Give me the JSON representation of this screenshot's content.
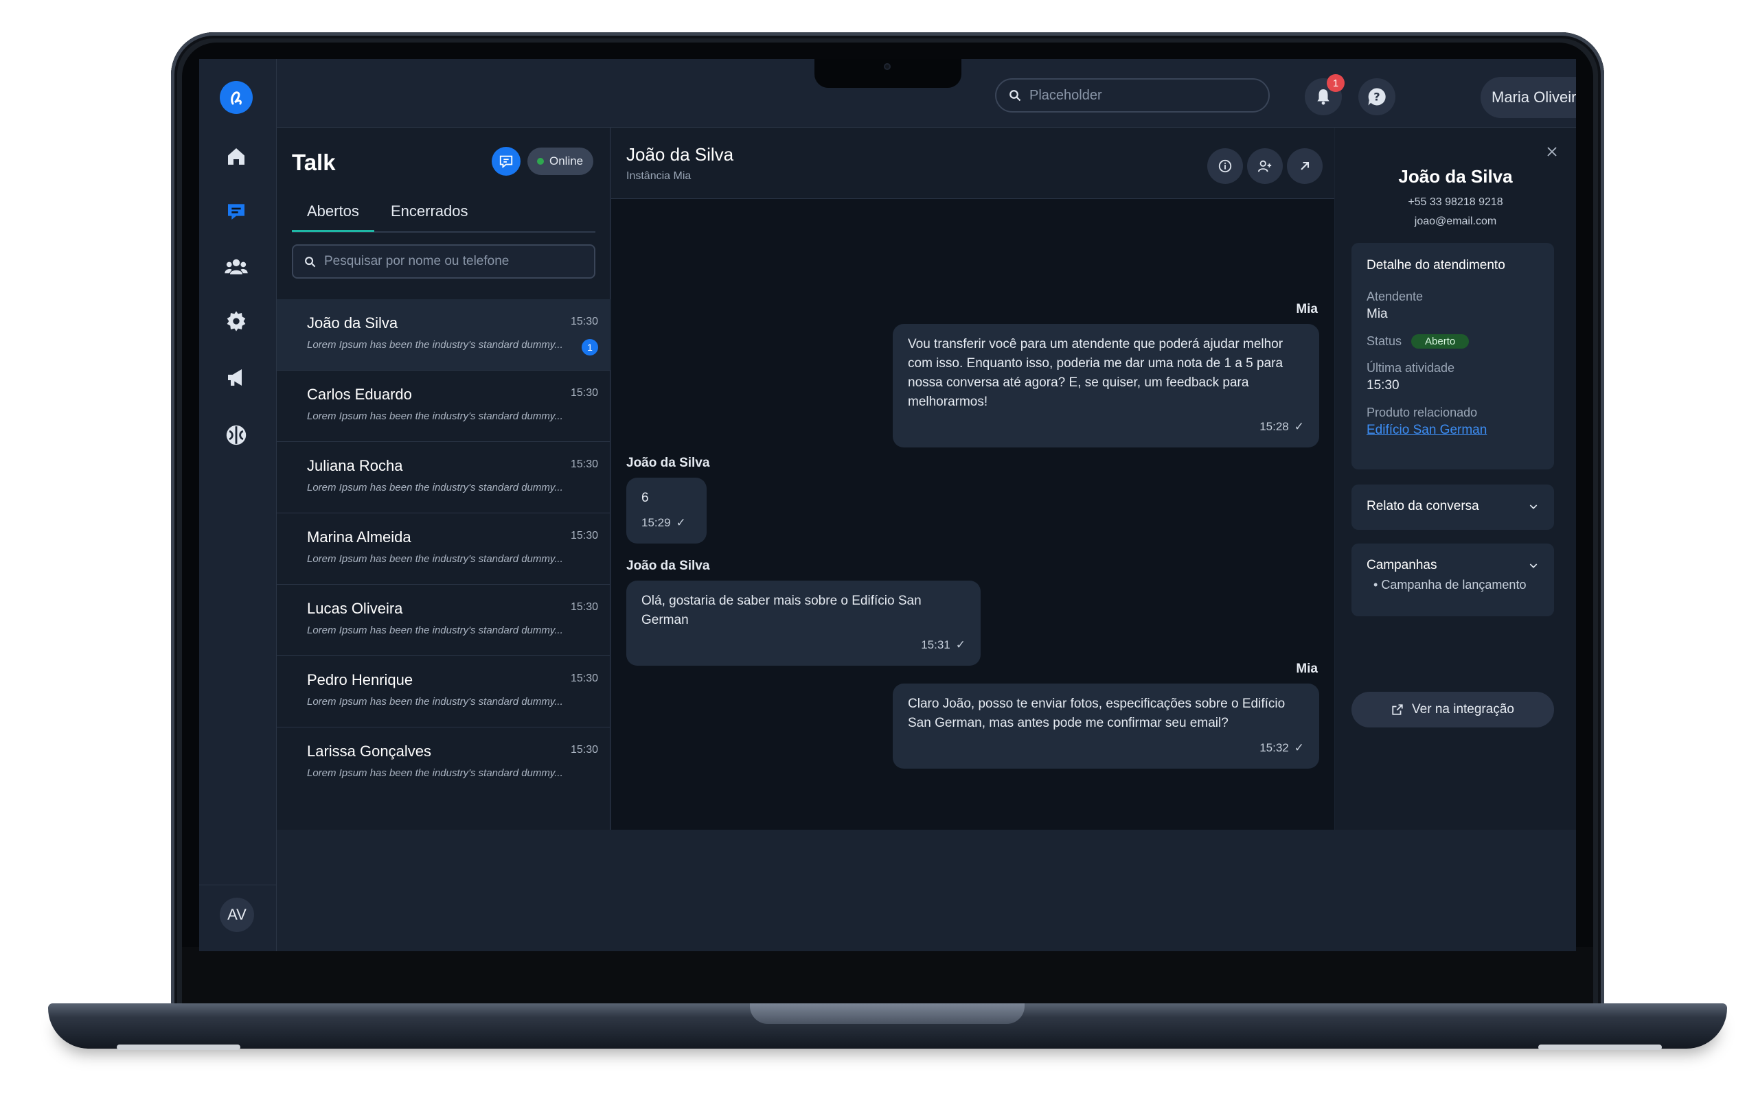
{
  "topbar": {
    "search_placeholder": "Placeholder",
    "notification_count": "1",
    "user_name": "Maria Oliveira"
  },
  "rail": {
    "items": [
      "home-icon",
      "chat-icon",
      "users-icon",
      "settings-icon",
      "megaphone-icon",
      "ai-brain-icon"
    ],
    "avatar_initials": "AV"
  },
  "list": {
    "title": "Talk",
    "online_label": "Online",
    "tabs": [
      "Abertos",
      "Encerrados"
    ],
    "search_placeholder": "Pesquisar por nome ou telefone",
    "conversations": [
      {
        "name": "João da Silva",
        "time": "15:30",
        "preview": "Lorem Ipsum has been the industry's standard dummy...",
        "unread": "1"
      },
      {
        "name": "Carlos Eduardo",
        "time": "15:30",
        "preview": "Lorem Ipsum has been the industry's standard dummy..."
      },
      {
        "name": "Juliana Rocha",
        "time": "15:30",
        "preview": "Lorem Ipsum has been the industry's standard dummy..."
      },
      {
        "name": "Marina Almeida",
        "time": "15:30",
        "preview": "Lorem Ipsum has been the industry's standard dummy..."
      },
      {
        "name": "Lucas Oliveira",
        "time": "15:30",
        "preview": "Lorem Ipsum has been the industry's standard dummy..."
      },
      {
        "name": "Pedro Henrique",
        "time": "15:30",
        "preview": "Lorem Ipsum has been the industry's standard dummy..."
      },
      {
        "name": "Larissa Gonçalves",
        "time": "15:30",
        "preview": "Lorem Ipsum has been the industry's standard dummy..."
      }
    ]
  },
  "chat": {
    "title": "João da Silva",
    "subtitle": "Instância Mia",
    "messages": [
      {
        "sender": "Mia",
        "text": "Vou transferir você para um atendente que poderá ajudar melhor com isso. Enquanto isso, poderia me dar uma nota de 1 a 5 para nossa conversa até agora? E, se quiser, um feedback para melhorarmos!",
        "time": "15:28"
      },
      {
        "sender": "João da Silva",
        "text": "6",
        "time": "15:29"
      },
      {
        "sender": "João da Silva",
        "text": "Olá, gostaria de saber mais sobre o Edifício San German",
        "time": "15:31"
      },
      {
        "sender": "Mia",
        "text": "Claro João, posso te enviar fotos, especificações sobre o Edifício San German, mas antes pode me confirmar seu email?",
        "time": "15:32"
      }
    ]
  },
  "detail": {
    "name": "João da Silva",
    "phone": "+55 33 98218 9218",
    "email": "joao@email.com",
    "service_card": {
      "title": "Detalhe do atendimento",
      "agent_label": "Atendente",
      "agent_value": "Mia",
      "status_label": "Status",
      "status_value": "Aberto",
      "last_activity_label": "Última atividade",
      "last_activity_value": "15:30",
      "product_label": "Produto relacionado",
      "product_value": "Edifício San German"
    },
    "report_label": "Relato da conversa",
    "campaigns_label": "Campanhas",
    "campaign_items": [
      "Campanha de lançamento"
    ],
    "integration_button": "Ver na integração"
  },
  "colors": {
    "accent": "#1877f2",
    "teal_tab": "#1fb8a6",
    "status_green": "#1e5a2c",
    "badge_red": "#e5484d"
  }
}
